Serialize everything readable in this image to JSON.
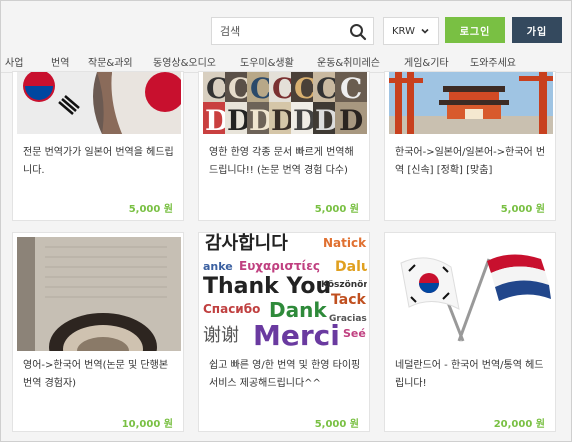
{
  "header": {
    "search_placeholder": "검색",
    "currency": "KRW",
    "login_label": "로그인",
    "join_label": "가입"
  },
  "nav": {
    "items": [
      "사업",
      "번역",
      "작문&과외",
      "동영상&오디오",
      "도우미&생활",
      "운동&취미레슨",
      "게임&기타",
      "도와주세요"
    ]
  },
  "thanks_words": {
    "line1": "감사합니다",
    "natick": "Natick",
    "danke": "anke",
    "greek": "Ευχαριστίες",
    "dalu": "Dalu",
    "thankyou": "Thank You",
    "koszonom": "Köszönöm",
    "tack": "Tack",
    "spasibo": "Спасибо",
    "dank": "Dank",
    "gracias": "Gracias",
    "xiexie": "谢谢",
    "merci": "Merci",
    "see": "Seé"
  },
  "cards": [
    {
      "title": "전문 번역가가 일본어 번역을 헤드립니다.",
      "price": "5,000 원"
    },
    {
      "title": "영한 한영 각종 문서 빠르게 번역해드립니다!! (논문 번역 경험 다수)",
      "price": "5,000 원"
    },
    {
      "title": "한국어->일본어/일본어->한국어 번역 [신속] [정확] [맞춤]",
      "price": "5,000 원"
    },
    {
      "title": "영어->한국어 번역(논문 및 단행본 번역 경험자)",
      "price": "10,000 원"
    },
    {
      "title": "쉽고 빠른 영/한 번역 및 한영 타이핑 서비스 제공해드립니다^^",
      "price": "5,000 원"
    },
    {
      "title": "네덜란드어 - 한국어 번역/통역 헤드립니다!",
      "price": "20,000 원"
    }
  ],
  "colors": {
    "accent_green": "#79c043",
    "dark_button": "#34495e"
  }
}
